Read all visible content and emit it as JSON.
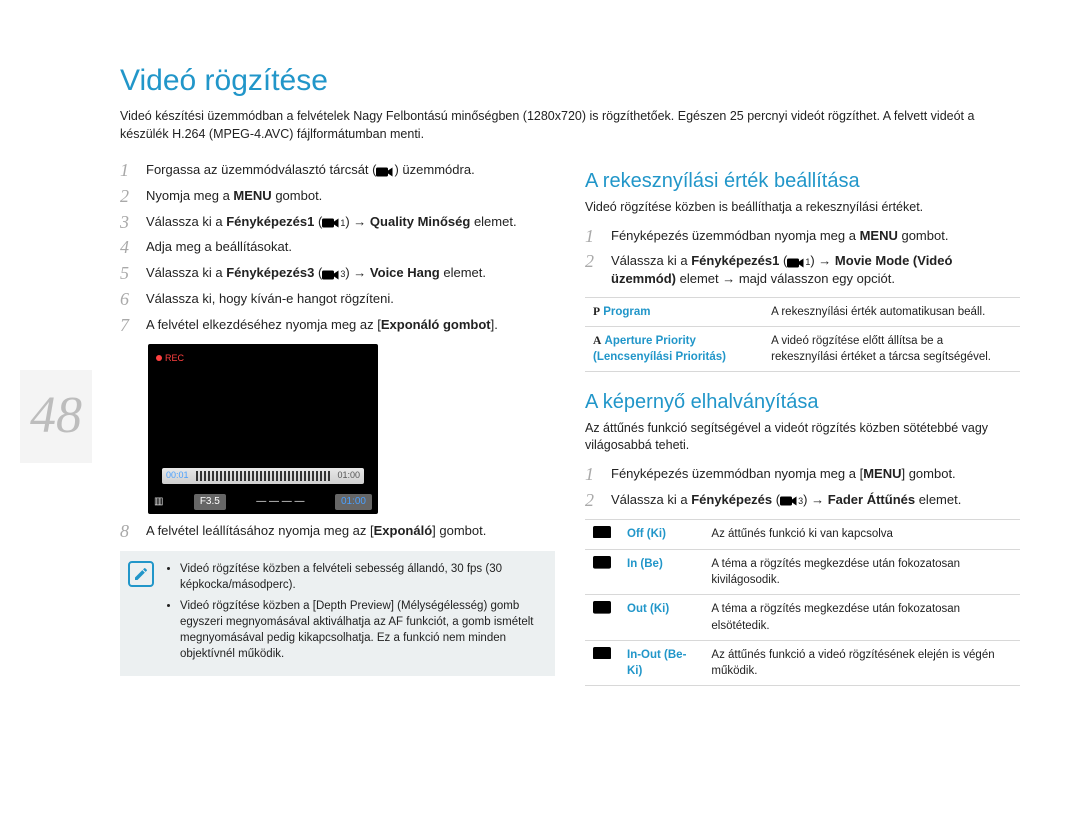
{
  "page_number": "48",
  "title": "Videó rögzítése",
  "intro": "Videó készítési üzemmódban a felvételek Nagy Felbontású minőségben (1280x720) is rögzíthetőek. Egészen 25 percnyi videót rögzíthet. A felvett videót a készülék H.264 (MPEG-4.AVC) fájlformátumban menti.",
  "left_steps": [
    {
      "n": "1",
      "pre": "Forgassa az üzemmódválasztó tárcsát ",
      "icon": true,
      "post": " üzemmódra."
    },
    {
      "n": "2",
      "pre": "Nyomja meg a ",
      "bold1": "MENU",
      "post": " gombot."
    },
    {
      "n": "3",
      "pre": "Válassza ki a ",
      "bold1": "Fényképezés1",
      "icon": true,
      "iconSub": "1",
      "arrow": " → ",
      "bold2": "Quality Minőség",
      "post": " elemet."
    },
    {
      "n": "4",
      "pre": "Adja meg a beállításokat."
    },
    {
      "n": "5",
      "pre": "Válassza ki a ",
      "bold1": "Fényképezés3",
      "icon": true,
      "iconSub": "3",
      "arrow": " → ",
      "bold2": "Voice Hang",
      "post": " elemet."
    },
    {
      "n": "6",
      "pre": "Válassza ki, hogy kíván-e hangot rögzíteni."
    },
    {
      "n": "7",
      "pre": "A felvétel elkezdéséhez nyomja meg az [",
      "bold1": "Exponáló gombot",
      "post": "]."
    },
    {
      "n": "8",
      "pre": "A felvétel leállításához nyomja meg az [",
      "bold1": "Exponáló",
      "post": "] gombot."
    }
  ],
  "lcd": {
    "rec": "REC",
    "t1": "00:01",
    "t2": "01:00",
    "ev": "",
    "f": "F3.5",
    "timebox": "01:00"
  },
  "note_bullets": [
    {
      "pre": "Videó rögzítése közben a felvételi sebesség állandó, 30 fps (30 képkocka/másodperc)."
    },
    {
      "pre": "Videó rögzítése közben a [",
      "bold": "Depth Preview",
      "post": "] (Mélységélesség) gomb egyszeri megnyomásával aktiválhatja az AF funkciót, a gomb ismételt megnyomásával pedig kikapcsolhatja. Ez a funkció nem minden objektívnél működik."
    }
  ],
  "aperture": {
    "heading": "A rekesznyílási érték beállítása",
    "intro": "Videó rögzítése közben is beállíthatja a rekesznyílási értéket.",
    "steps": [
      {
        "n": "1",
        "pre": "Fényképezés üzemmódban nyomja meg a ",
        "bold1": "MENU",
        "post": " gombot."
      },
      {
        "n": "2",
        "pre": "Válassza ki a ",
        "bold1": "Fényképezés1",
        "icon": true,
        "iconSub": "1",
        "arrow": " → ",
        "bold2": "Movie Mode (Videó üzemmód)",
        "mid": " elemet → majd válasszon egy opciót."
      }
    ],
    "rows": [
      {
        "letter": "P",
        "name": "Program",
        "desc": "A rekesznyílási érték automatikusan beáll."
      },
      {
        "letter": "A",
        "name": "Aperture Priority (Lencsenyílási Prioritás)",
        "desc": "A videó rögzítése előtt állítsa be a rekesznyílási értéket a tárcsa segítségével."
      }
    ]
  },
  "fader": {
    "heading": "A képernyő elhalványítása",
    "intro": "Az áttűnés funkció segítségével a videót rögzítés közben sötétebbé vagy világosabbá teheti.",
    "steps": [
      {
        "n": "1",
        "pre": "Fényképezés üzemmódban nyomja meg a [",
        "bold1": "MENU",
        "post": "] gombot."
      },
      {
        "n": "2",
        "pre": "Válassza ki a ",
        "bold1": "Fényképezés",
        "icon": true,
        "iconSub": "3",
        "arrow": " → ",
        "bold2": "Fader Áttűnés",
        "post": " elemet."
      }
    ],
    "rows": [
      {
        "name": "Off (Ki)",
        "desc": "Az áttűnés funkció ki van kapcsolva"
      },
      {
        "name": "In (Be)",
        "desc": "A téma a rögzítés megkezdése után fokozatosan kivilágosodik."
      },
      {
        "name": "Out (Ki)",
        "desc": "A téma a rögzítés megkezdése után fokozatosan elsötétedik."
      },
      {
        "name": "In-Out (Be-Ki)",
        "desc": "Az áttűnés funkció a videó rögzítésének elején is végén működik."
      }
    ]
  }
}
